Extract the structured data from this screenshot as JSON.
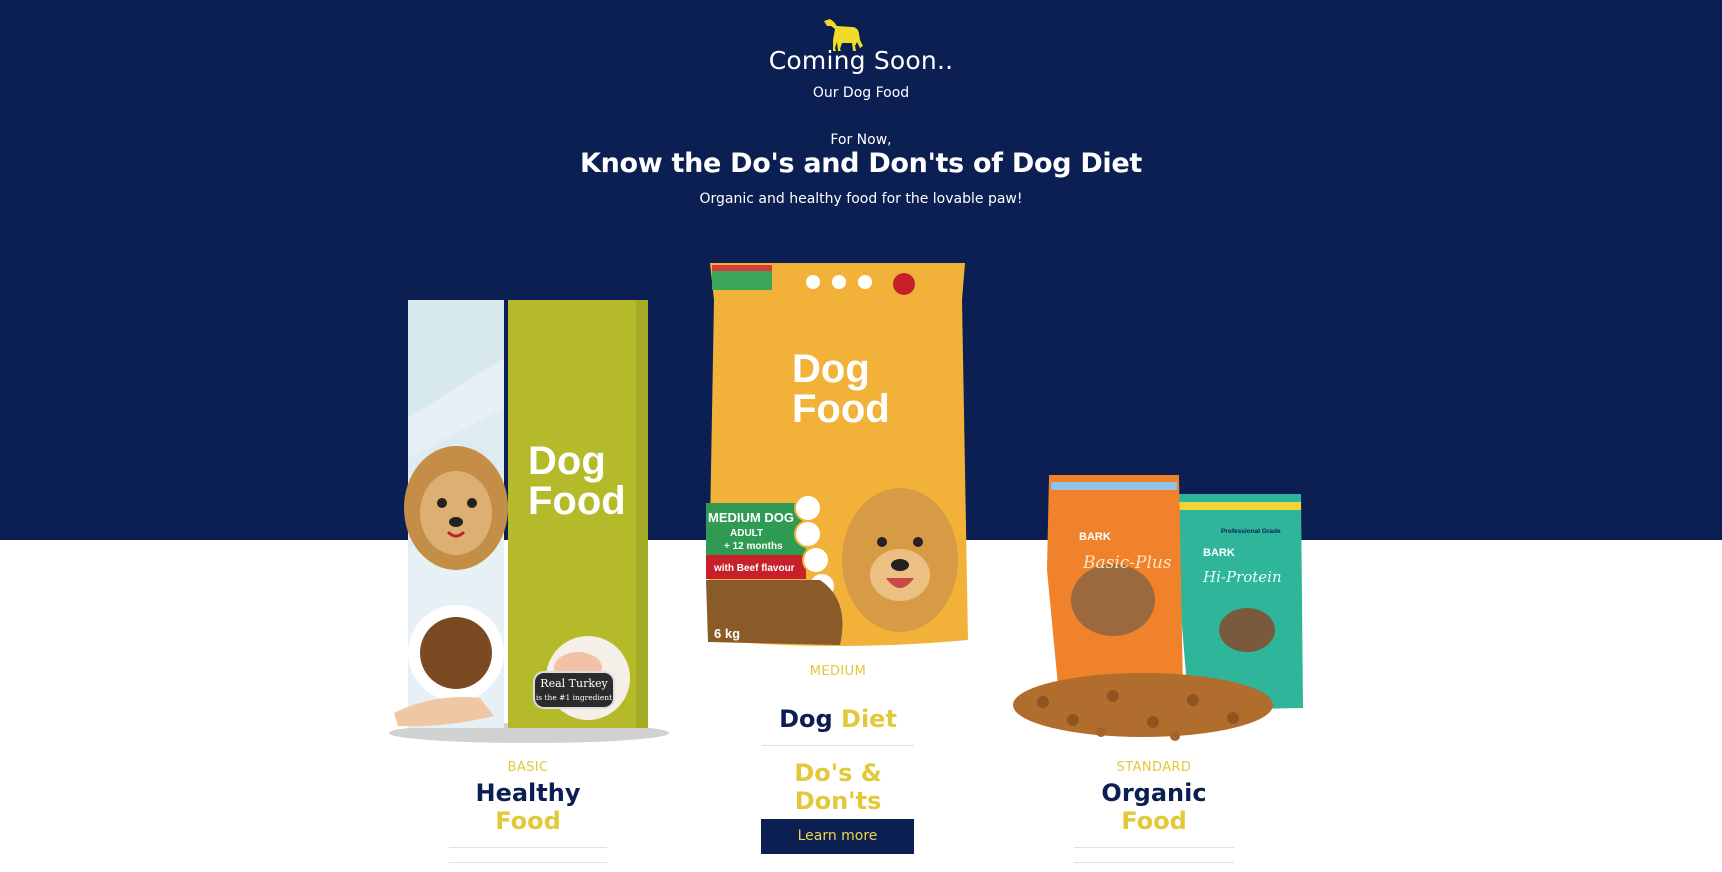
{
  "hero": {
    "title": "Coming Soon..",
    "subtitle": "Our Dog Food",
    "intro": "For Now,",
    "heading": "Know the Do's and Don'ts of Dog Diet",
    "tagline": "Organic and healthy food for the lovable paw!"
  },
  "products": {
    "left": {
      "bag_line1": "Dog",
      "bag_line2": "Food",
      "badge": "Real Turkey",
      "badge_sub": "is the #1 ingredient",
      "kicker": "BASIC",
      "title_a": "Healthy",
      "title_b": "Food"
    },
    "center": {
      "bag_line1": "Dog",
      "bag_line2": "Food",
      "band1": "MEDIUM DOG",
      "band2": "ADULT",
      "band3": "+ 12 months",
      "band4": "with Beef flavour",
      "weight": "6 kg",
      "kicker": "MEDIUM",
      "title_a": "Dog",
      "title_b": "Diet",
      "sub_title": "Do's & Don'ts",
      "button": "Learn more"
    },
    "right": {
      "brand1": "BARK",
      "brand2": "BARK",
      "bag1": "Basic-Plus",
      "bag2": "Hi-Protein",
      "grade": "Professional Grade",
      "kicker": "STANDARD",
      "title_a": "Organic",
      "title_b": "Food"
    }
  },
  "colors": {
    "navy": "#0b1f53",
    "accent": "#e3c83a"
  }
}
